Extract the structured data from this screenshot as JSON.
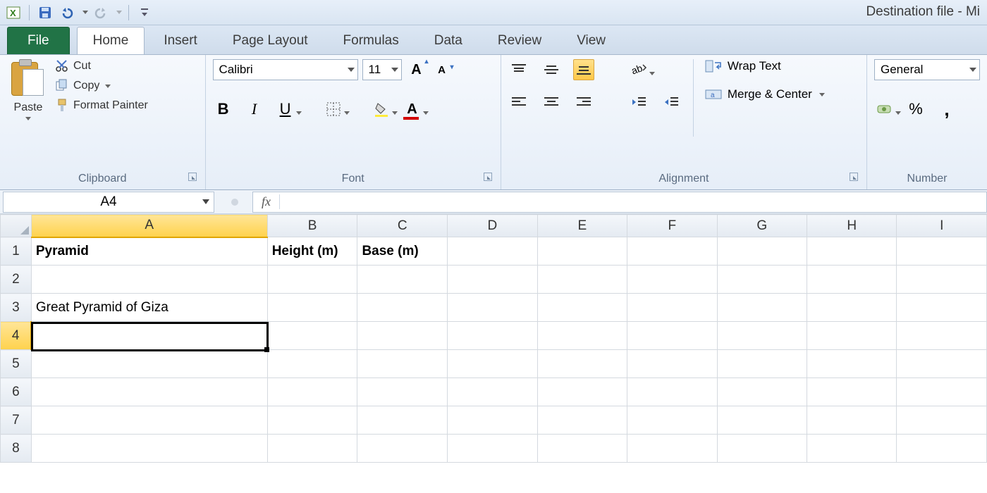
{
  "window_title": "Destination file  -  Mi",
  "qat": {
    "save_tip": "Save",
    "undo_tip": "Undo",
    "redo_tip": "Redo"
  },
  "tabs": {
    "file": "File",
    "items": [
      "Home",
      "Insert",
      "Page Layout",
      "Formulas",
      "Data",
      "Review",
      "View"
    ],
    "active": 0
  },
  "clipboard": {
    "paste": "Paste",
    "cut": "Cut",
    "copy": "Copy",
    "format_painter": "Format Painter",
    "group_label": "Clipboard"
  },
  "font": {
    "name": "Calibri",
    "size": "11",
    "group_label": "Font"
  },
  "alignment": {
    "wrap": "Wrap Text",
    "merge": "Merge & Center",
    "group_label": "Alignment"
  },
  "number": {
    "format": "General",
    "percent": "%",
    "comma": ",",
    "group_label": "Number"
  },
  "formula_bar": {
    "name_box": "A4",
    "fx": "fx",
    "value": ""
  },
  "columns": [
    "A",
    "B",
    "C",
    "D",
    "E",
    "F",
    "G",
    "H",
    "I"
  ],
  "col_widths": {
    "A": 336,
    "other": 128
  },
  "rows": [
    "1",
    "2",
    "3",
    "4",
    "5",
    "6",
    "7",
    "8"
  ],
  "cells": {
    "A1": "Pyramid",
    "B1": "Height (m)",
    "C1": "Base (m)",
    "A3": "Great Pyramid of Giza"
  },
  "selection": {
    "cell": "A4"
  }
}
